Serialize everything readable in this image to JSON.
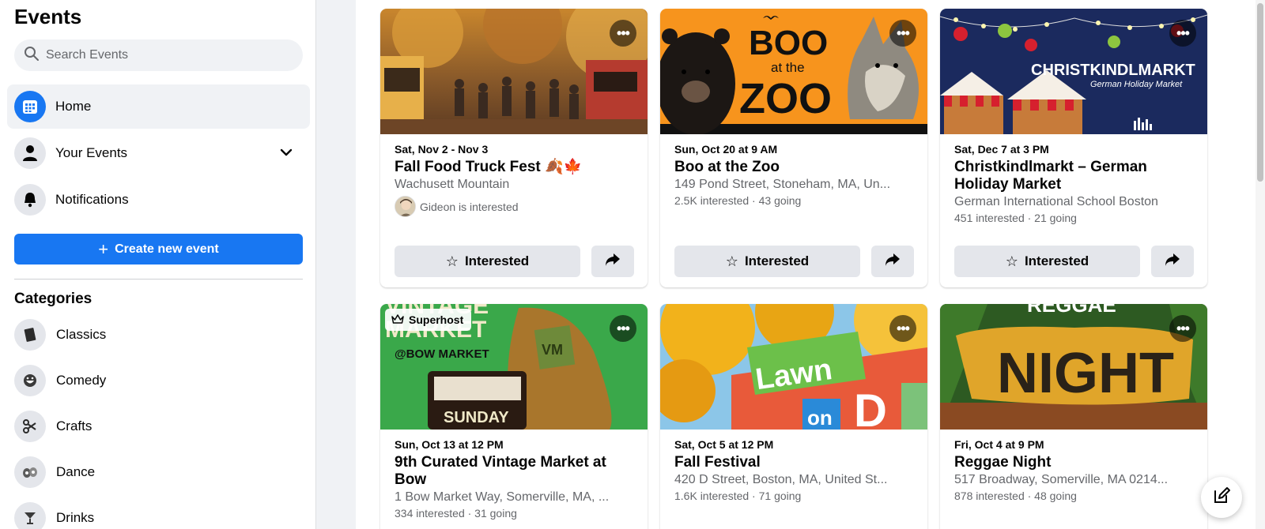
{
  "sidebar": {
    "title": "Events",
    "search_placeholder": "Search Events",
    "nav": [
      {
        "label": "Home",
        "icon": "calendar-icon",
        "active": true
      },
      {
        "label": "Your Events",
        "icon": "person-icon"
      },
      {
        "label": "Notifications",
        "icon": "bell-icon"
      }
    ],
    "create_label": "Create new event",
    "categories_title": "Categories",
    "categories": [
      {
        "label": "Classics",
        "icon": "book-icon"
      },
      {
        "label": "Comedy",
        "icon": "laugh-icon"
      },
      {
        "label": "Crafts",
        "icon": "scissors-icon"
      },
      {
        "label": "Dance",
        "icon": "dance-shoes-icon"
      },
      {
        "label": "Drinks",
        "icon": "cocktail-icon"
      }
    ]
  },
  "events": [
    {
      "date": "Sat, Nov 2 - Nov 3",
      "title": "Fall Food Truck Fest 🍂🍁",
      "location": "Wachusett Mountain",
      "friend": "Gideon is interested",
      "button": "Interested"
    },
    {
      "date": "Sun, Oct 20 at 9 AM",
      "title": "Boo at the Zoo",
      "location": "149 Pond Street, Stoneham, MA, Un...",
      "stats": "2.5K interested · 43 going",
      "button": "Interested",
      "image_text": {
        "boo": "BOO",
        "at_the": "at the",
        "zoo": "ZOO"
      }
    },
    {
      "date": "Sat, Dec 7 at 3 PM",
      "title": "Christkindlmarkt – German Holiday Market",
      "location": "German International School Boston",
      "stats": "451 interested · 21 going",
      "button": "Interested",
      "image_text": {
        "main": "CHRISTKINDLMARKT",
        "sub": "German Holiday Market"
      }
    },
    {
      "date": "Sun, Oct 13 at 12 PM",
      "title": "9th Curated Vintage Market at Bow",
      "location": "1 Bow Market Way, Somerville, MA, ...",
      "stats": "334 interested · 31 going",
      "badge": "Superhost",
      "image_text": {
        "top": "VINTAGE",
        "market": "MARKET",
        "bow": "@BOW MARKET",
        "day": "SUNDAY",
        "vm": "VM"
      }
    },
    {
      "date": "Sat, Oct 5 at 12 PM",
      "title": "Fall Festival",
      "location": "420 D Street, Boston, MA, United St...",
      "stats": "1.6K interested · 71 going",
      "image_text": {
        "lawn": "Lawn",
        "on": "on",
        "d": "D"
      }
    },
    {
      "date": "Fri, Oct 4 at 9 PM",
      "title": "Reggae Night",
      "location": "517 Broadway, Somerville, MA 0214...",
      "stats": "878 interested · 48 going",
      "image_text": {
        "top": "REGGAE",
        "night": "NIGHT"
      }
    }
  ],
  "colors": {
    "accent": "#1877f2",
    "secondary_text": "#65676b"
  }
}
